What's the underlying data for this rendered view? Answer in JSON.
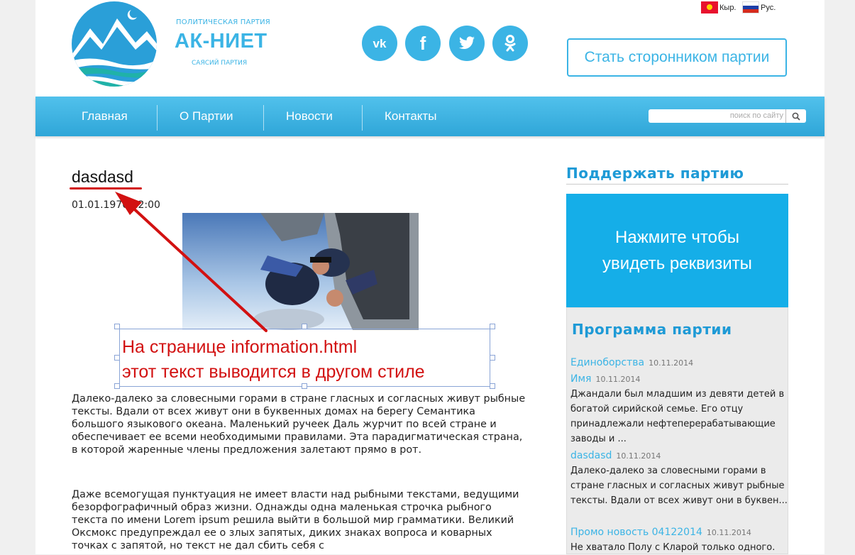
{
  "header": {
    "brand_small": "ПОЛИТИЧЕСКАЯ ПАРТИЯ",
    "brand_name": "АК-НИЕТ",
    "brand_sub": "САЯСИЙ ПАРТИЯ",
    "social": [
      {
        "name": "vk",
        "label": "vk"
      },
      {
        "name": "facebook",
        "label": "f"
      },
      {
        "name": "twitter",
        "label": "t"
      },
      {
        "name": "odnoklassniki",
        "label": "ok"
      }
    ],
    "lang_kg": "Кыр.",
    "lang_ru": "Рус.",
    "support_button": "Стать сторонником партии"
  },
  "nav": {
    "items": [
      "Главная",
      "О Партии",
      "Новости",
      "Контакты"
    ],
    "search_placeholder": "поиск по сайту"
  },
  "article": {
    "title": "dasdasd",
    "date": "01.01.1970 12:00",
    "annotation_line1": "На странице information.html",
    "annotation_line2": "этот текст выводится в другом стиле",
    "paragraph1": "Далеко-далеко за словесными горами в стране гласных и согласных живут рыбные тексты. Вдали от всех живут они в буквенных домах на берегу Семантика большого языкового океана. Маленький ручеек Даль журчит по всей стране и обеспечивает ее всеми необходимыми правилами. Эта парадигматическая страна, в которой жаренные члены предложения залетают прямо в рот.",
    "paragraph2": "Даже всемогущая пунктуация не имеет власти над рыбными текстами, ведущими безорфографичный образ жизни. Однажды одна маленькая строчка рыбного текста по имени Lorem ipsum решила выйти в большой мир грамматики. Великий Оксмокс предупреждал ее о злых запятых, диких знаках вопроса и коварных точках с запятой, но текст не дал сбить себя с"
  },
  "sidebar": {
    "support_title": "Поддержать партию",
    "requisites_line1": "Нажмите чтобы",
    "requisites_line2": "увидеть реквизиты",
    "program_title": "Программа партии",
    "news": [
      {
        "title": "Единоборства",
        "date": "10.11.2014",
        "text": ""
      },
      {
        "title": "Имя",
        "date": "10.11.2014",
        "text": "Джандали был младшим из девяти детей в богатой сирийской семье. Его отцу принадлежали нефтеперерабатывающие заводы и ..."
      },
      {
        "title": "dasdasd",
        "date": "10.11.2014",
        "text": "Далеко-далеко за словесными горами в стране гласных и согласных живут рыбные тексты. Вдали от всех живут они в буквен..."
      },
      {
        "title": "Промо новость 04122014",
        "date": "10.11.2014",
        "text": "Не хватало Полу с Кларой только одного."
      }
    ]
  },
  "colors": {
    "accent": "#3bb4e5",
    "nav_top": "#51c1ec",
    "nav_bottom": "#2fa6d8",
    "annotation_red": "#d21111",
    "requisites_bg": "#15aee8"
  }
}
